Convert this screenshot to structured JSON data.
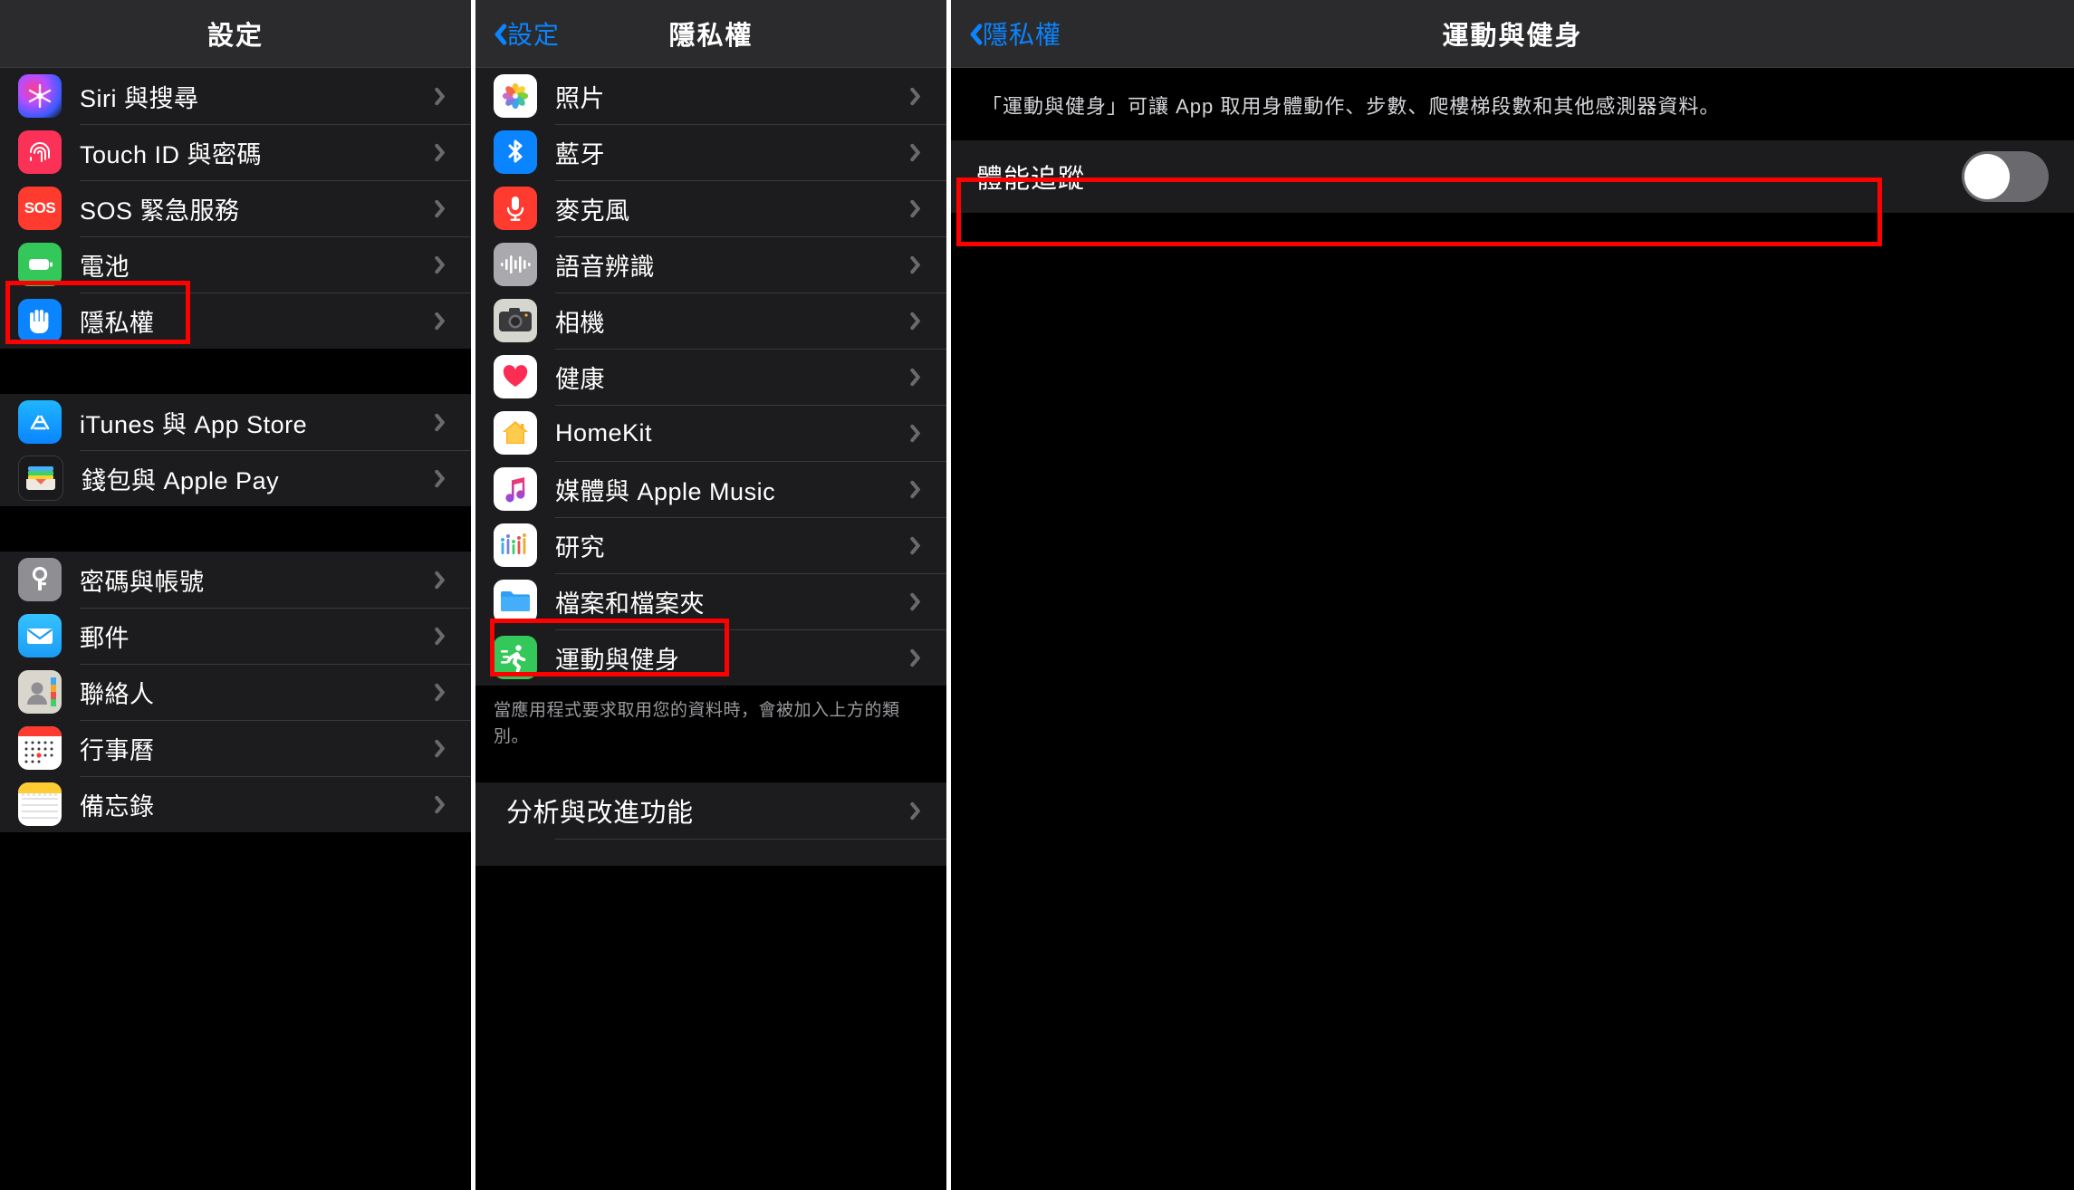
{
  "panel1": {
    "nav": {
      "title": "設定"
    },
    "groups": [
      {
        "items": [
          {
            "label": "Siri 與搜尋",
            "icon": "siri-icon"
          },
          {
            "label": "Touch ID 與密碼",
            "icon": "touchid-icon"
          },
          {
            "label": "SOS 緊急服務",
            "icon": "sos-icon"
          },
          {
            "label": "電池",
            "icon": "battery-icon"
          },
          {
            "label": "隱私權",
            "icon": "privacy-hand-icon",
            "highlight": true
          }
        ]
      },
      {
        "items": [
          {
            "label": "iTunes 與 App Store",
            "icon": "appstore-icon"
          },
          {
            "label": "錢包與 Apple Pay",
            "icon": "wallet-icon"
          }
        ]
      },
      {
        "items": [
          {
            "label": "密碼與帳號",
            "icon": "key-icon"
          },
          {
            "label": "郵件",
            "icon": "mail-icon"
          },
          {
            "label": "聯絡人",
            "icon": "contacts-icon"
          },
          {
            "label": "行事曆",
            "icon": "calendar-icon"
          },
          {
            "label": "備忘錄",
            "icon": "notes-icon"
          }
        ]
      }
    ]
  },
  "panel2": {
    "nav": {
      "back_label": "設定",
      "title": "隱私權"
    },
    "items": [
      {
        "label": "照片",
        "icon": "photos-icon"
      },
      {
        "label": "藍牙",
        "icon": "bluetooth-icon"
      },
      {
        "label": "麥克風",
        "icon": "microphone-icon"
      },
      {
        "label": "語音辨識",
        "icon": "speech-recognition-icon"
      },
      {
        "label": "相機",
        "icon": "camera-icon"
      },
      {
        "label": "健康",
        "icon": "health-icon"
      },
      {
        "label": "HomeKit",
        "icon": "homekit-icon"
      },
      {
        "label": "媒體與 Apple Music",
        "icon": "music-icon"
      },
      {
        "label": "研究",
        "icon": "research-icon"
      },
      {
        "label": "檔案和檔案夾",
        "icon": "files-icon"
      },
      {
        "label": "運動與健身",
        "icon": "motion-fitness-icon",
        "highlight": true
      }
    ],
    "footer_note": "當應用程式要求取用您的資料時，會被加入上方的類別。",
    "analytics": {
      "label": "分析與改進功能"
    }
  },
  "panel3": {
    "nav": {
      "back_label": "隱私權",
      "title": "運動與健身"
    },
    "description": "「運動與健身」可讓 App 取用身體動作、步數、爬樓梯段數和其他感測器資料。",
    "toggle": {
      "label": "體能追蹤",
      "state": "off"
    }
  },
  "colors": {
    "highlight": "#ff0000",
    "accent_blue": "#0a84ff",
    "row_bg": "#1c1c1e",
    "nav_bg": "#2b2b2d",
    "separator": "#3a3a3c"
  }
}
